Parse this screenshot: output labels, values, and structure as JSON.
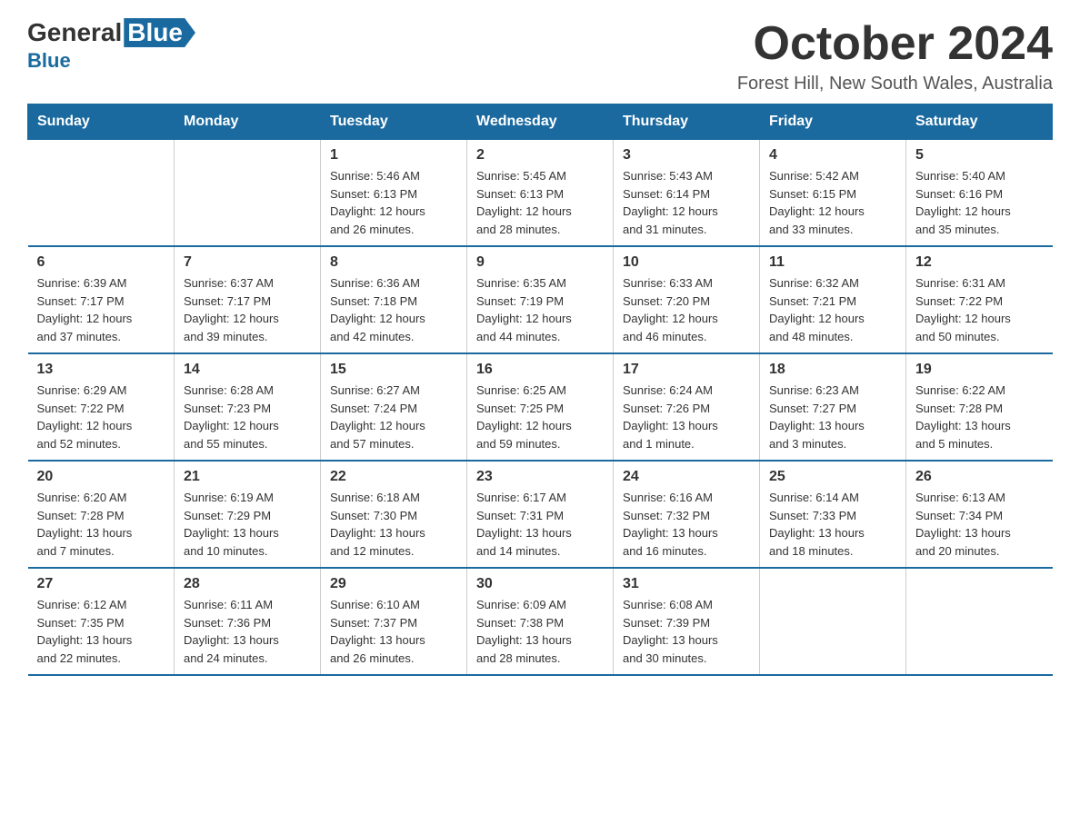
{
  "logo": {
    "general": "General",
    "blue": "Blue"
  },
  "title": "October 2024",
  "location": "Forest Hill, New South Wales, Australia",
  "days_of_week": [
    "Sunday",
    "Monday",
    "Tuesday",
    "Wednesday",
    "Thursday",
    "Friday",
    "Saturday"
  ],
  "weeks": [
    [
      {
        "day": "",
        "info": ""
      },
      {
        "day": "",
        "info": ""
      },
      {
        "day": "1",
        "info": "Sunrise: 5:46 AM\nSunset: 6:13 PM\nDaylight: 12 hours\nand 26 minutes."
      },
      {
        "day": "2",
        "info": "Sunrise: 5:45 AM\nSunset: 6:13 PM\nDaylight: 12 hours\nand 28 minutes."
      },
      {
        "day": "3",
        "info": "Sunrise: 5:43 AM\nSunset: 6:14 PM\nDaylight: 12 hours\nand 31 minutes."
      },
      {
        "day": "4",
        "info": "Sunrise: 5:42 AM\nSunset: 6:15 PM\nDaylight: 12 hours\nand 33 minutes."
      },
      {
        "day": "5",
        "info": "Sunrise: 5:40 AM\nSunset: 6:16 PM\nDaylight: 12 hours\nand 35 minutes."
      }
    ],
    [
      {
        "day": "6",
        "info": "Sunrise: 6:39 AM\nSunset: 7:17 PM\nDaylight: 12 hours\nand 37 minutes."
      },
      {
        "day": "7",
        "info": "Sunrise: 6:37 AM\nSunset: 7:17 PM\nDaylight: 12 hours\nand 39 minutes."
      },
      {
        "day": "8",
        "info": "Sunrise: 6:36 AM\nSunset: 7:18 PM\nDaylight: 12 hours\nand 42 minutes."
      },
      {
        "day": "9",
        "info": "Sunrise: 6:35 AM\nSunset: 7:19 PM\nDaylight: 12 hours\nand 44 minutes."
      },
      {
        "day": "10",
        "info": "Sunrise: 6:33 AM\nSunset: 7:20 PM\nDaylight: 12 hours\nand 46 minutes."
      },
      {
        "day": "11",
        "info": "Sunrise: 6:32 AM\nSunset: 7:21 PM\nDaylight: 12 hours\nand 48 minutes."
      },
      {
        "day": "12",
        "info": "Sunrise: 6:31 AM\nSunset: 7:22 PM\nDaylight: 12 hours\nand 50 minutes."
      }
    ],
    [
      {
        "day": "13",
        "info": "Sunrise: 6:29 AM\nSunset: 7:22 PM\nDaylight: 12 hours\nand 52 minutes."
      },
      {
        "day": "14",
        "info": "Sunrise: 6:28 AM\nSunset: 7:23 PM\nDaylight: 12 hours\nand 55 minutes."
      },
      {
        "day": "15",
        "info": "Sunrise: 6:27 AM\nSunset: 7:24 PM\nDaylight: 12 hours\nand 57 minutes."
      },
      {
        "day": "16",
        "info": "Sunrise: 6:25 AM\nSunset: 7:25 PM\nDaylight: 12 hours\nand 59 minutes."
      },
      {
        "day": "17",
        "info": "Sunrise: 6:24 AM\nSunset: 7:26 PM\nDaylight: 13 hours\nand 1 minute."
      },
      {
        "day": "18",
        "info": "Sunrise: 6:23 AM\nSunset: 7:27 PM\nDaylight: 13 hours\nand 3 minutes."
      },
      {
        "day": "19",
        "info": "Sunrise: 6:22 AM\nSunset: 7:28 PM\nDaylight: 13 hours\nand 5 minutes."
      }
    ],
    [
      {
        "day": "20",
        "info": "Sunrise: 6:20 AM\nSunset: 7:28 PM\nDaylight: 13 hours\nand 7 minutes."
      },
      {
        "day": "21",
        "info": "Sunrise: 6:19 AM\nSunset: 7:29 PM\nDaylight: 13 hours\nand 10 minutes."
      },
      {
        "day": "22",
        "info": "Sunrise: 6:18 AM\nSunset: 7:30 PM\nDaylight: 13 hours\nand 12 minutes."
      },
      {
        "day": "23",
        "info": "Sunrise: 6:17 AM\nSunset: 7:31 PM\nDaylight: 13 hours\nand 14 minutes."
      },
      {
        "day": "24",
        "info": "Sunrise: 6:16 AM\nSunset: 7:32 PM\nDaylight: 13 hours\nand 16 minutes."
      },
      {
        "day": "25",
        "info": "Sunrise: 6:14 AM\nSunset: 7:33 PM\nDaylight: 13 hours\nand 18 minutes."
      },
      {
        "day": "26",
        "info": "Sunrise: 6:13 AM\nSunset: 7:34 PM\nDaylight: 13 hours\nand 20 minutes."
      }
    ],
    [
      {
        "day": "27",
        "info": "Sunrise: 6:12 AM\nSunset: 7:35 PM\nDaylight: 13 hours\nand 22 minutes."
      },
      {
        "day": "28",
        "info": "Sunrise: 6:11 AM\nSunset: 7:36 PM\nDaylight: 13 hours\nand 24 minutes."
      },
      {
        "day": "29",
        "info": "Sunrise: 6:10 AM\nSunset: 7:37 PM\nDaylight: 13 hours\nand 26 minutes."
      },
      {
        "day": "30",
        "info": "Sunrise: 6:09 AM\nSunset: 7:38 PM\nDaylight: 13 hours\nand 28 minutes."
      },
      {
        "day": "31",
        "info": "Sunrise: 6:08 AM\nSunset: 7:39 PM\nDaylight: 13 hours\nand 30 minutes."
      },
      {
        "day": "",
        "info": ""
      },
      {
        "day": "",
        "info": ""
      }
    ]
  ]
}
